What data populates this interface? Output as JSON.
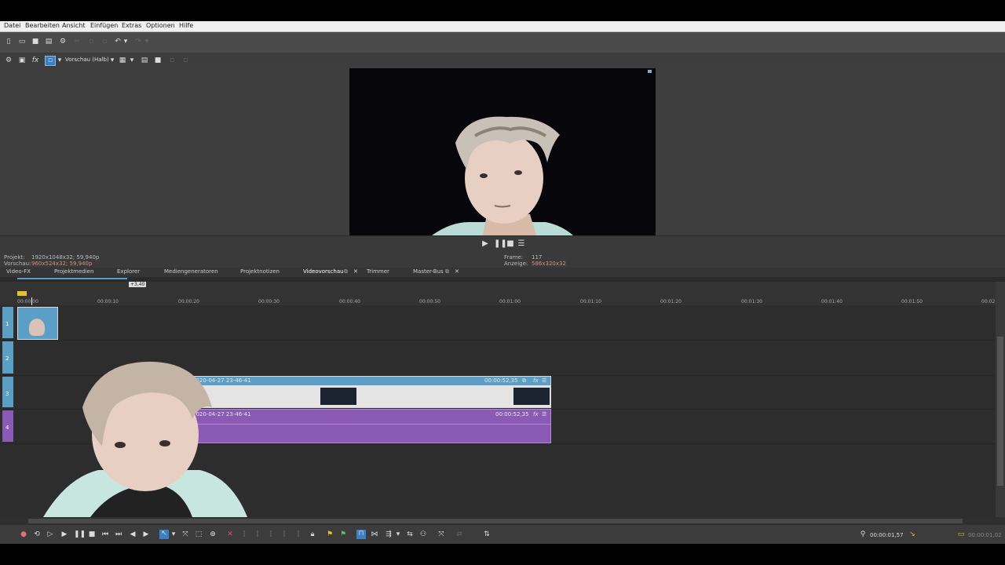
{
  "menu": {
    "items": [
      "Datei",
      "Bearbeiten",
      "Ansicht",
      "Einfügen",
      "Extras",
      "Optionen",
      "Hilfe"
    ]
  },
  "preview_toolbar": {
    "quality_label": "Vorschau (Halb)"
  },
  "project_info": {
    "projekt_label": "Projekt:",
    "projekt_value": "1920x1048x32; 59,940p",
    "vorschau_label": "Vorschau:",
    "vorschau_value": "960x524x32; 59,940p",
    "frame_label": "Frame:",
    "frame_value": "117",
    "anzeige_label": "Anzeige:",
    "anzeige_value": "586x320x32"
  },
  "tabs": [
    "Video-FX",
    "Projektmedien",
    "Explorer",
    "Mediengeneratoren",
    "Projektnotizen",
    "Videovorschau",
    "Trimmer",
    "Master-Bus"
  ],
  "ruler": {
    "rate_badge": "+3,40",
    "ticks": [
      "00:00:00",
      "00:00:10",
      "00:00:20",
      "00:00:30",
      "00:00:40",
      "00:00:50",
      "00:01:00",
      "00:01:10",
      "00:01:20",
      "00:01:30",
      "00:01:40",
      "00:01:50",
      "00:02"
    ]
  },
  "tracks": {
    "track1_num": "1",
    "track2_num": "2",
    "track3_num": "3",
    "track4_num": "4",
    "video_clip_name": "2020-04-27 23-46-41",
    "video_clip_len": "00:00:52,35",
    "audio_clip_name": "2020-04-27 23-46-41",
    "audio_clip_len": "00:00:52,35"
  },
  "status": {
    "cursor_time": "00:00:01,57",
    "selection_len": "00:00:01,02"
  },
  "colors": {
    "video_track": "#5b9fc6",
    "audio_track": "#8a5ab4",
    "accent": "#3b7fc4"
  }
}
